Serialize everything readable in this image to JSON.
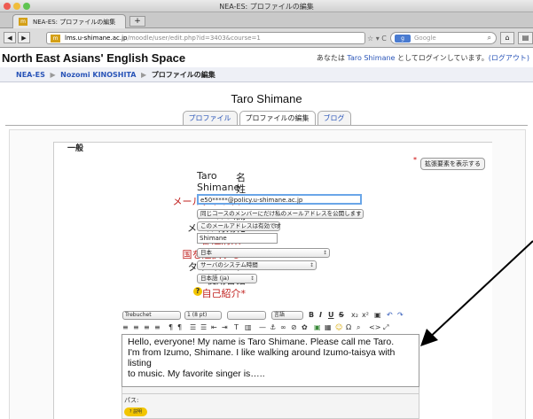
{
  "window": {
    "title": "NEA-ES: プロファイルの編集"
  },
  "tab": {
    "label": "NEA-ES: プロファイルの編集",
    "favicon": "m",
    "new_tab": "+"
  },
  "url": {
    "host": "lms.u-shimane.ac.jp",
    "path": "/moodle/user/edit.php?id=3403&course=1",
    "favicon": "m"
  },
  "search": {
    "placeholder": "Google",
    "engine": "g"
  },
  "site": {
    "name": "North East Asians' English Space"
  },
  "login": {
    "prefix": "あなたは",
    "user": "Taro Shimane",
    "middle": "としてログインしています。",
    "logout": "(ログアウト)"
  },
  "breadcrumb": {
    "home": "NEA-ES",
    "user": "Nozomi KINOSHITA",
    "current": "プロファイルの編集",
    "sep": "▶"
  },
  "page": {
    "user_name": "Taro Shimane"
  },
  "tabs": [
    {
      "label": "プロファイル",
      "active": false
    },
    {
      "label": "プロファイルの編集",
      "active": true
    },
    {
      "label": "ブログ",
      "active": false
    }
  ],
  "form": {
    "legend": "一般",
    "advanced_button": "拡張要素を表示する",
    "required_mark": "*",
    "first_name": {
      "label": "名",
      "value": "Taro"
    },
    "last_name": {
      "label": "姓",
      "value": "Shimane"
    },
    "email": {
      "label": "メールアドレス*",
      "value": "e50*****@policy.u-shimane.ac.jp"
    },
    "email_display": {
      "label": "メール公開",
      "value": "同じコースのメンバーにだけ私のメールアドレスを公開します"
    },
    "email_enabled": {
      "label": "メール有効化",
      "value": "このメールアドレスは有効です"
    },
    "city": {
      "label": "都道府県*",
      "value": "Shimane"
    },
    "country": {
      "label": "国を選択する*",
      "value": "日本"
    },
    "timezone": {
      "label": "タイムゾーン",
      "value": "サーバのシステム時間"
    },
    "language": {
      "label": "使用言語",
      "value": "日本語 (ja)"
    },
    "description": {
      "label": "自己紹介*",
      "help": "?"
    }
  },
  "editor": {
    "font": "Trebuchet",
    "size": "1 (8 pt)",
    "format": "",
    "lang": "言語",
    "text_line1": "Hello, everyone! My name is Taro Shimane. Please call me Taro.",
    "text_line2": "I'm from Izumo, Shimane. I like walking around Izumo-taisya with listing",
    "text_line3": "to music. My favorite singer is…..",
    "path_label": "パス:",
    "help_label": "? 説明"
  },
  "colors": {
    "accent": "#2a55b8",
    "required": "#c0201e",
    "focus": "#6aa6e8"
  }
}
